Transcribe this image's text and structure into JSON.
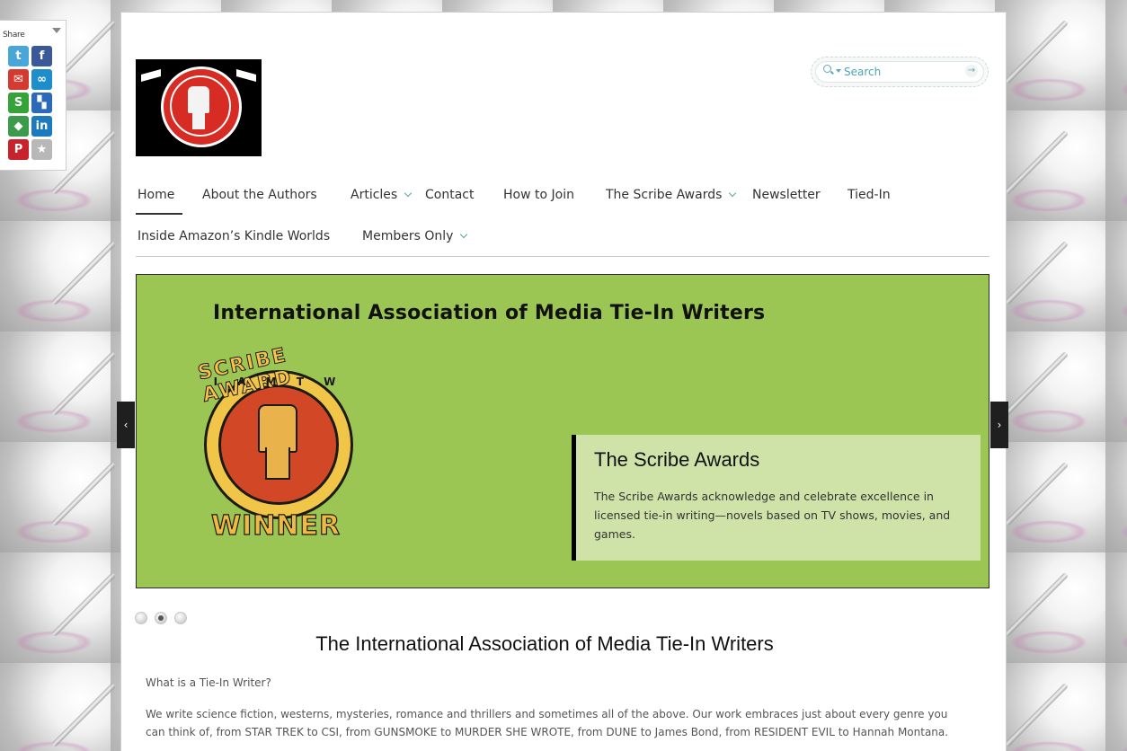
{
  "share": {
    "title": "Share",
    "icons": [
      {
        "name": "twitter-icon",
        "glyph": "t",
        "color": "#4aa6d6"
      },
      {
        "name": "facebook-icon",
        "glyph": "f",
        "color": "#3b5998"
      },
      {
        "name": "email-icon",
        "glyph": "✉",
        "color": "#d43a2f"
      },
      {
        "name": "infinity-icon",
        "glyph": "∞",
        "color": "#1d8ecb"
      },
      {
        "name": "stumbleupon-icon",
        "glyph": "S",
        "color": "#36a33a"
      },
      {
        "name": "delicious-icon",
        "glyph": "▚",
        "color": "#2b6ab8"
      },
      {
        "name": "google-bookmarks-icon",
        "glyph": "◆",
        "color": "#3c9b4a"
      },
      {
        "name": "linkedin-icon",
        "glyph": "in",
        "color": "#1d7bbd"
      },
      {
        "name": "pinterest-icon",
        "glyph": "P",
        "color": "#c8232c"
      },
      {
        "name": "favorites-star-icon",
        "glyph": "★",
        "color": "#b8b8b8"
      }
    ]
  },
  "search": {
    "placeholder": "Search"
  },
  "nav": {
    "items": [
      {
        "label": "Home",
        "has_dropdown": false,
        "active": true
      },
      {
        "label": "About the Authors",
        "has_dropdown": false
      },
      {
        "label": "Articles",
        "has_dropdown": true
      },
      {
        "label": "Contact",
        "has_dropdown": false
      },
      {
        "label": "How to Join",
        "has_dropdown": false
      },
      {
        "label": "The Scribe Awards",
        "has_dropdown": true
      },
      {
        "label": "Newsletter",
        "has_dropdown": false
      },
      {
        "label": "Tied-In",
        "has_dropdown": false
      },
      {
        "label": "Inside Amazon’s Kindle Worlds",
        "has_dropdown": false
      },
      {
        "label": "Members Only",
        "has_dropdown": true
      }
    ]
  },
  "slider": {
    "banner_title": "International Association of Media Tie-In Writers",
    "award": {
      "arc_text": "SCRIBE AWARD",
      "letters": "I A M T W",
      "winner": "WINNER"
    },
    "caption_title": "The Scribe Awards",
    "caption_text": "The Scribe Awards acknowledge and celebrate excellence in licensed tie-in writing—novels based on TV shows, movies, and games.",
    "prev_glyph": "‹",
    "next_glyph": "›",
    "dots": 3,
    "active_dot": 2,
    "background_color": "#9cc653"
  },
  "content": {
    "title": "The International Association of Media Tie-In Writers",
    "question": "What is a Tie-In Writer?",
    "paragraph": "We write science fiction, westerns, mysteries, romance and thrillers and sometimes all of the above. Our work embraces just about every genre you can think of, from STAR TREK to CSI, from GUNSMOKE to MURDER SHE WROTE, from DUNE to James Bond, from RESIDENT EVIL to Hannah Montana."
  }
}
